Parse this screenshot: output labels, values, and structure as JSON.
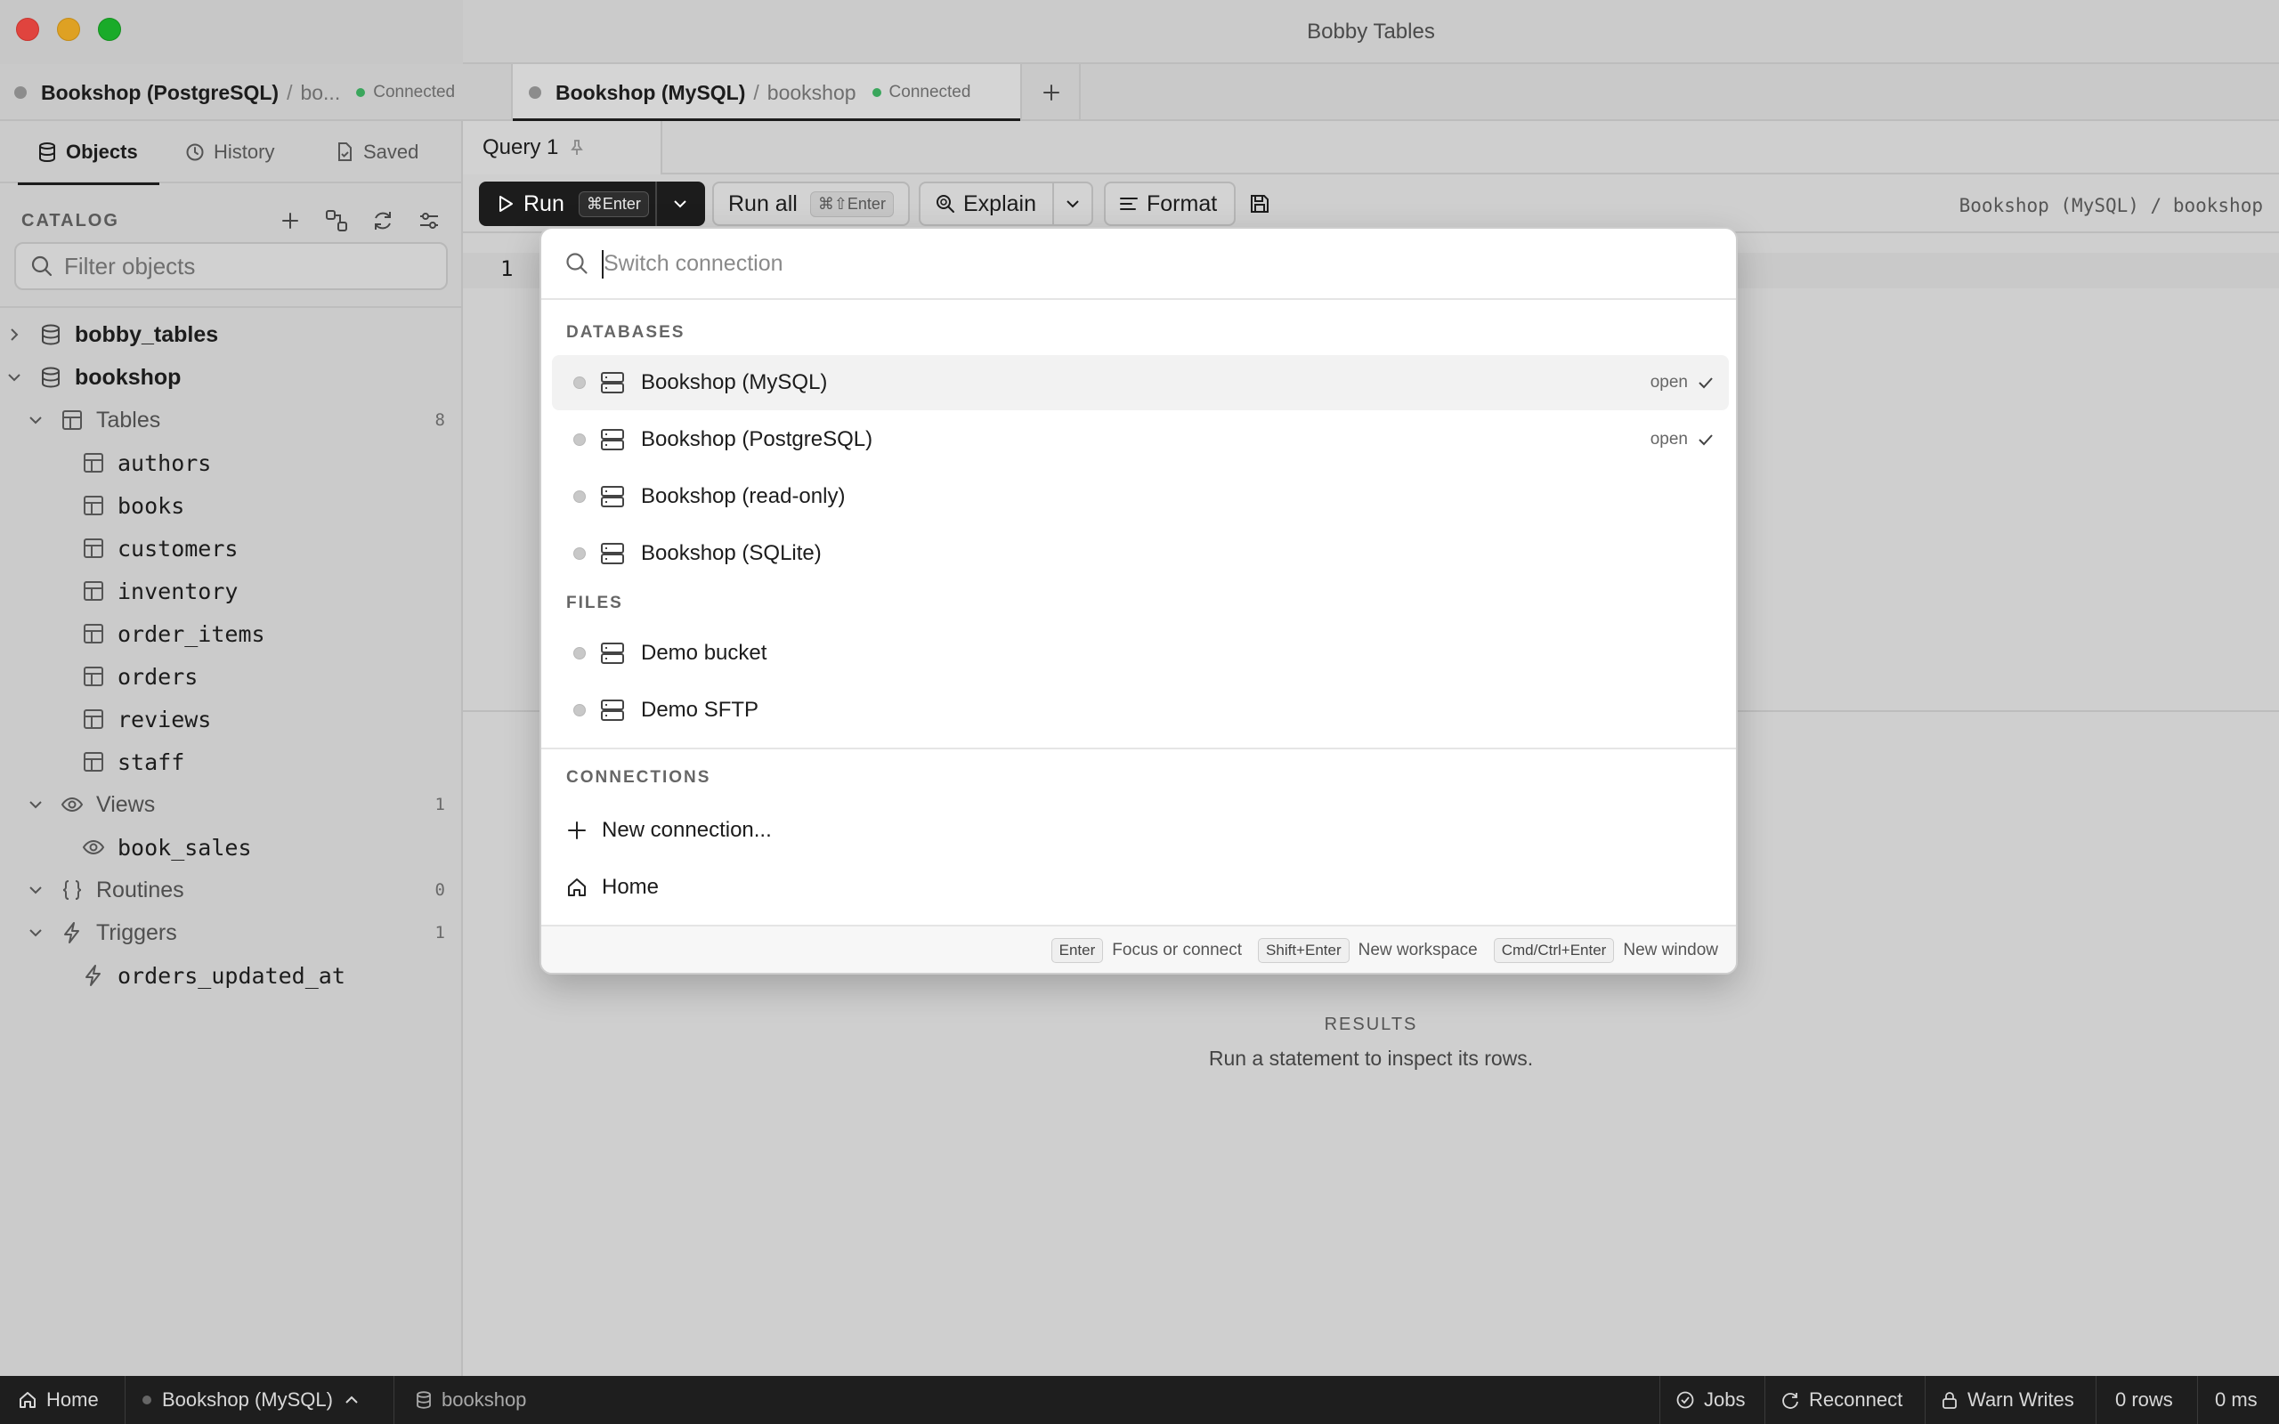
{
  "window": {
    "title": "Bobby Tables"
  },
  "connection_tabs": [
    {
      "name": "Bookshop (PostgreSQL)",
      "database": "bo...",
      "status": "Connected",
      "active": false
    },
    {
      "name": "Bookshop (MySQL)",
      "database": "bookshop",
      "status": "Connected",
      "active": true
    }
  ],
  "sidebar": {
    "tabs": [
      {
        "label": "Objects",
        "icon": "database-icon",
        "active": true
      },
      {
        "label": "History",
        "icon": "clock-icon",
        "active": false
      },
      {
        "label": "Saved",
        "icon": "saved-file-icon",
        "active": false
      }
    ],
    "catalog_label": "CATALOG",
    "filter_placeholder": "Filter objects",
    "tree": {
      "db1": {
        "name": "bobby_tables"
      },
      "db2": {
        "name": "bookshop"
      },
      "tables": {
        "label": "Tables",
        "count": "8",
        "items": [
          "authors",
          "books",
          "customers",
          "inventory",
          "order_items",
          "orders",
          "reviews",
          "staff"
        ]
      },
      "views": {
        "label": "Views",
        "count": "1",
        "items": [
          "book_sales"
        ]
      },
      "routines": {
        "label": "Routines",
        "count": "0"
      },
      "triggers": {
        "label": "Triggers",
        "count": "1",
        "items": [
          "orders_updated_at"
        ]
      }
    }
  },
  "editor": {
    "query_tab": "Query 1",
    "toolbar": {
      "run": "Run",
      "run_shortcut": "⌘Enter",
      "run_all": "Run all",
      "run_all_shortcut": "⌘⇧Enter",
      "explain": "Explain",
      "format": "Format"
    },
    "breadcrumb": "Bookshop (MySQL) / bookshop",
    "line_number": "1"
  },
  "results": {
    "title": "RESULTS",
    "message": "Run a statement to inspect its rows."
  },
  "palette": {
    "placeholder": "Switch connection",
    "sections": {
      "databases": {
        "title": "DATABASES",
        "items": [
          {
            "label": "Bookshop (MySQL)",
            "status": "open",
            "selected": true
          },
          {
            "label": "Bookshop (PostgreSQL)",
            "status": "open",
            "selected": false
          },
          {
            "label": "Bookshop (read-only)",
            "status": "",
            "selected": false
          },
          {
            "label": "Bookshop (SQLite)",
            "status": "",
            "selected": false
          }
        ]
      },
      "files": {
        "title": "FILES",
        "items": [
          {
            "label": "Demo bucket"
          },
          {
            "label": "Demo SFTP"
          }
        ]
      },
      "connections": {
        "title": "CONNECTIONS",
        "items": [
          {
            "label": "New connection...",
            "icon": "plus-icon"
          },
          {
            "label": "Home",
            "icon": "home-icon"
          }
        ]
      }
    },
    "footer": [
      {
        "key": "Enter",
        "text": "Focus or connect"
      },
      {
        "key": "Shift+Enter",
        "text": "New workspace"
      },
      {
        "key": "Cmd/Ctrl+Enter",
        "text": "New window"
      }
    ]
  },
  "statusbar": {
    "home": "Home",
    "connection": "Bookshop (MySQL)",
    "database": "bookshop",
    "jobs": "Jobs",
    "reconnect": "Reconnect",
    "warn_writes": "Warn Writes",
    "rows": "0 rows",
    "time": "0 ms"
  }
}
